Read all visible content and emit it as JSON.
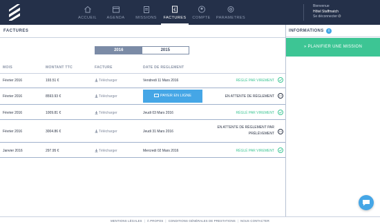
{
  "colors": {
    "header_bg": "#243049",
    "accent_blue": "#45a6e6",
    "success_green": "#3dc594",
    "year_active_bg": "#7b8ba6"
  },
  "header": {
    "nav": [
      {
        "label": "ACCUEIL",
        "icon": "home-icon"
      },
      {
        "label": "AGENDA",
        "icon": "calendar-icon"
      },
      {
        "label": "MISSIONS",
        "icon": "clipboard-icon"
      },
      {
        "label": "FACTURES",
        "icon": "invoice-icon",
        "active": true
      },
      {
        "label": "COMPTE",
        "icon": "user-icon"
      },
      {
        "label": "PARAMETRES",
        "icon": "gear-icon"
      }
    ],
    "user": {
      "greeting": "Bienvenue",
      "name": "Hôtel Staffmatch",
      "logout": "Se déconnecter"
    }
  },
  "main": {
    "title": "FACTURES",
    "years": [
      "2016",
      "2015"
    ],
    "columns": {
      "month": "MOIS",
      "amount": "MONTANT TTC",
      "invoice": "FACTURE",
      "date": "DATE DE REGLEMENT"
    },
    "download_label": "Télécharger",
    "rows": [
      {
        "month": "Février 2016",
        "amount": "193.51 €",
        "date": "Vendredi 11 Mars 2016",
        "status": "RÉGLÉ PAR VIREMENT",
        "status_type": "ok"
      },
      {
        "month": "Février 2016",
        "amount": "8593.93 €",
        "pay_label": "PAYER EN LIGNE",
        "status": "EN ATTENTE DE RÈGLEMENT",
        "status_type": "wait"
      },
      {
        "month": "Février 2016",
        "amount": "1009.81 €",
        "date": "Jeudi 03 Mars 2016",
        "status": "RÉGLÉ PAR VIREMENT",
        "status_type": "ok"
      },
      {
        "month": "Février 2016",
        "amount": "3004.86 €",
        "date": "Jeudi 31 Mars 2016",
        "status_line1": "EN ATTENTE DE RÈGLEMENT PAR",
        "status_line2": "PRÉLÈVEMENT",
        "status_type": "wait"
      },
      {
        "month": "Janvier 2016",
        "amount": "297.95 €",
        "date": "Mercredi 02 Mars 2016",
        "status": "RÉGLÉ PAR VIREMENT",
        "status_type": "ok"
      }
    ]
  },
  "side": {
    "title": "INFORMATIONS",
    "badge": "i",
    "plan_button": "» PLANIFIER UNE MISSION"
  },
  "footer": {
    "links": [
      "MENTIONS LÉGALES",
      "À PROPOS",
      "CONDITIONS GÉNÉRALES DE PRESTATIONS",
      "NOUS CONTACTER"
    ]
  }
}
